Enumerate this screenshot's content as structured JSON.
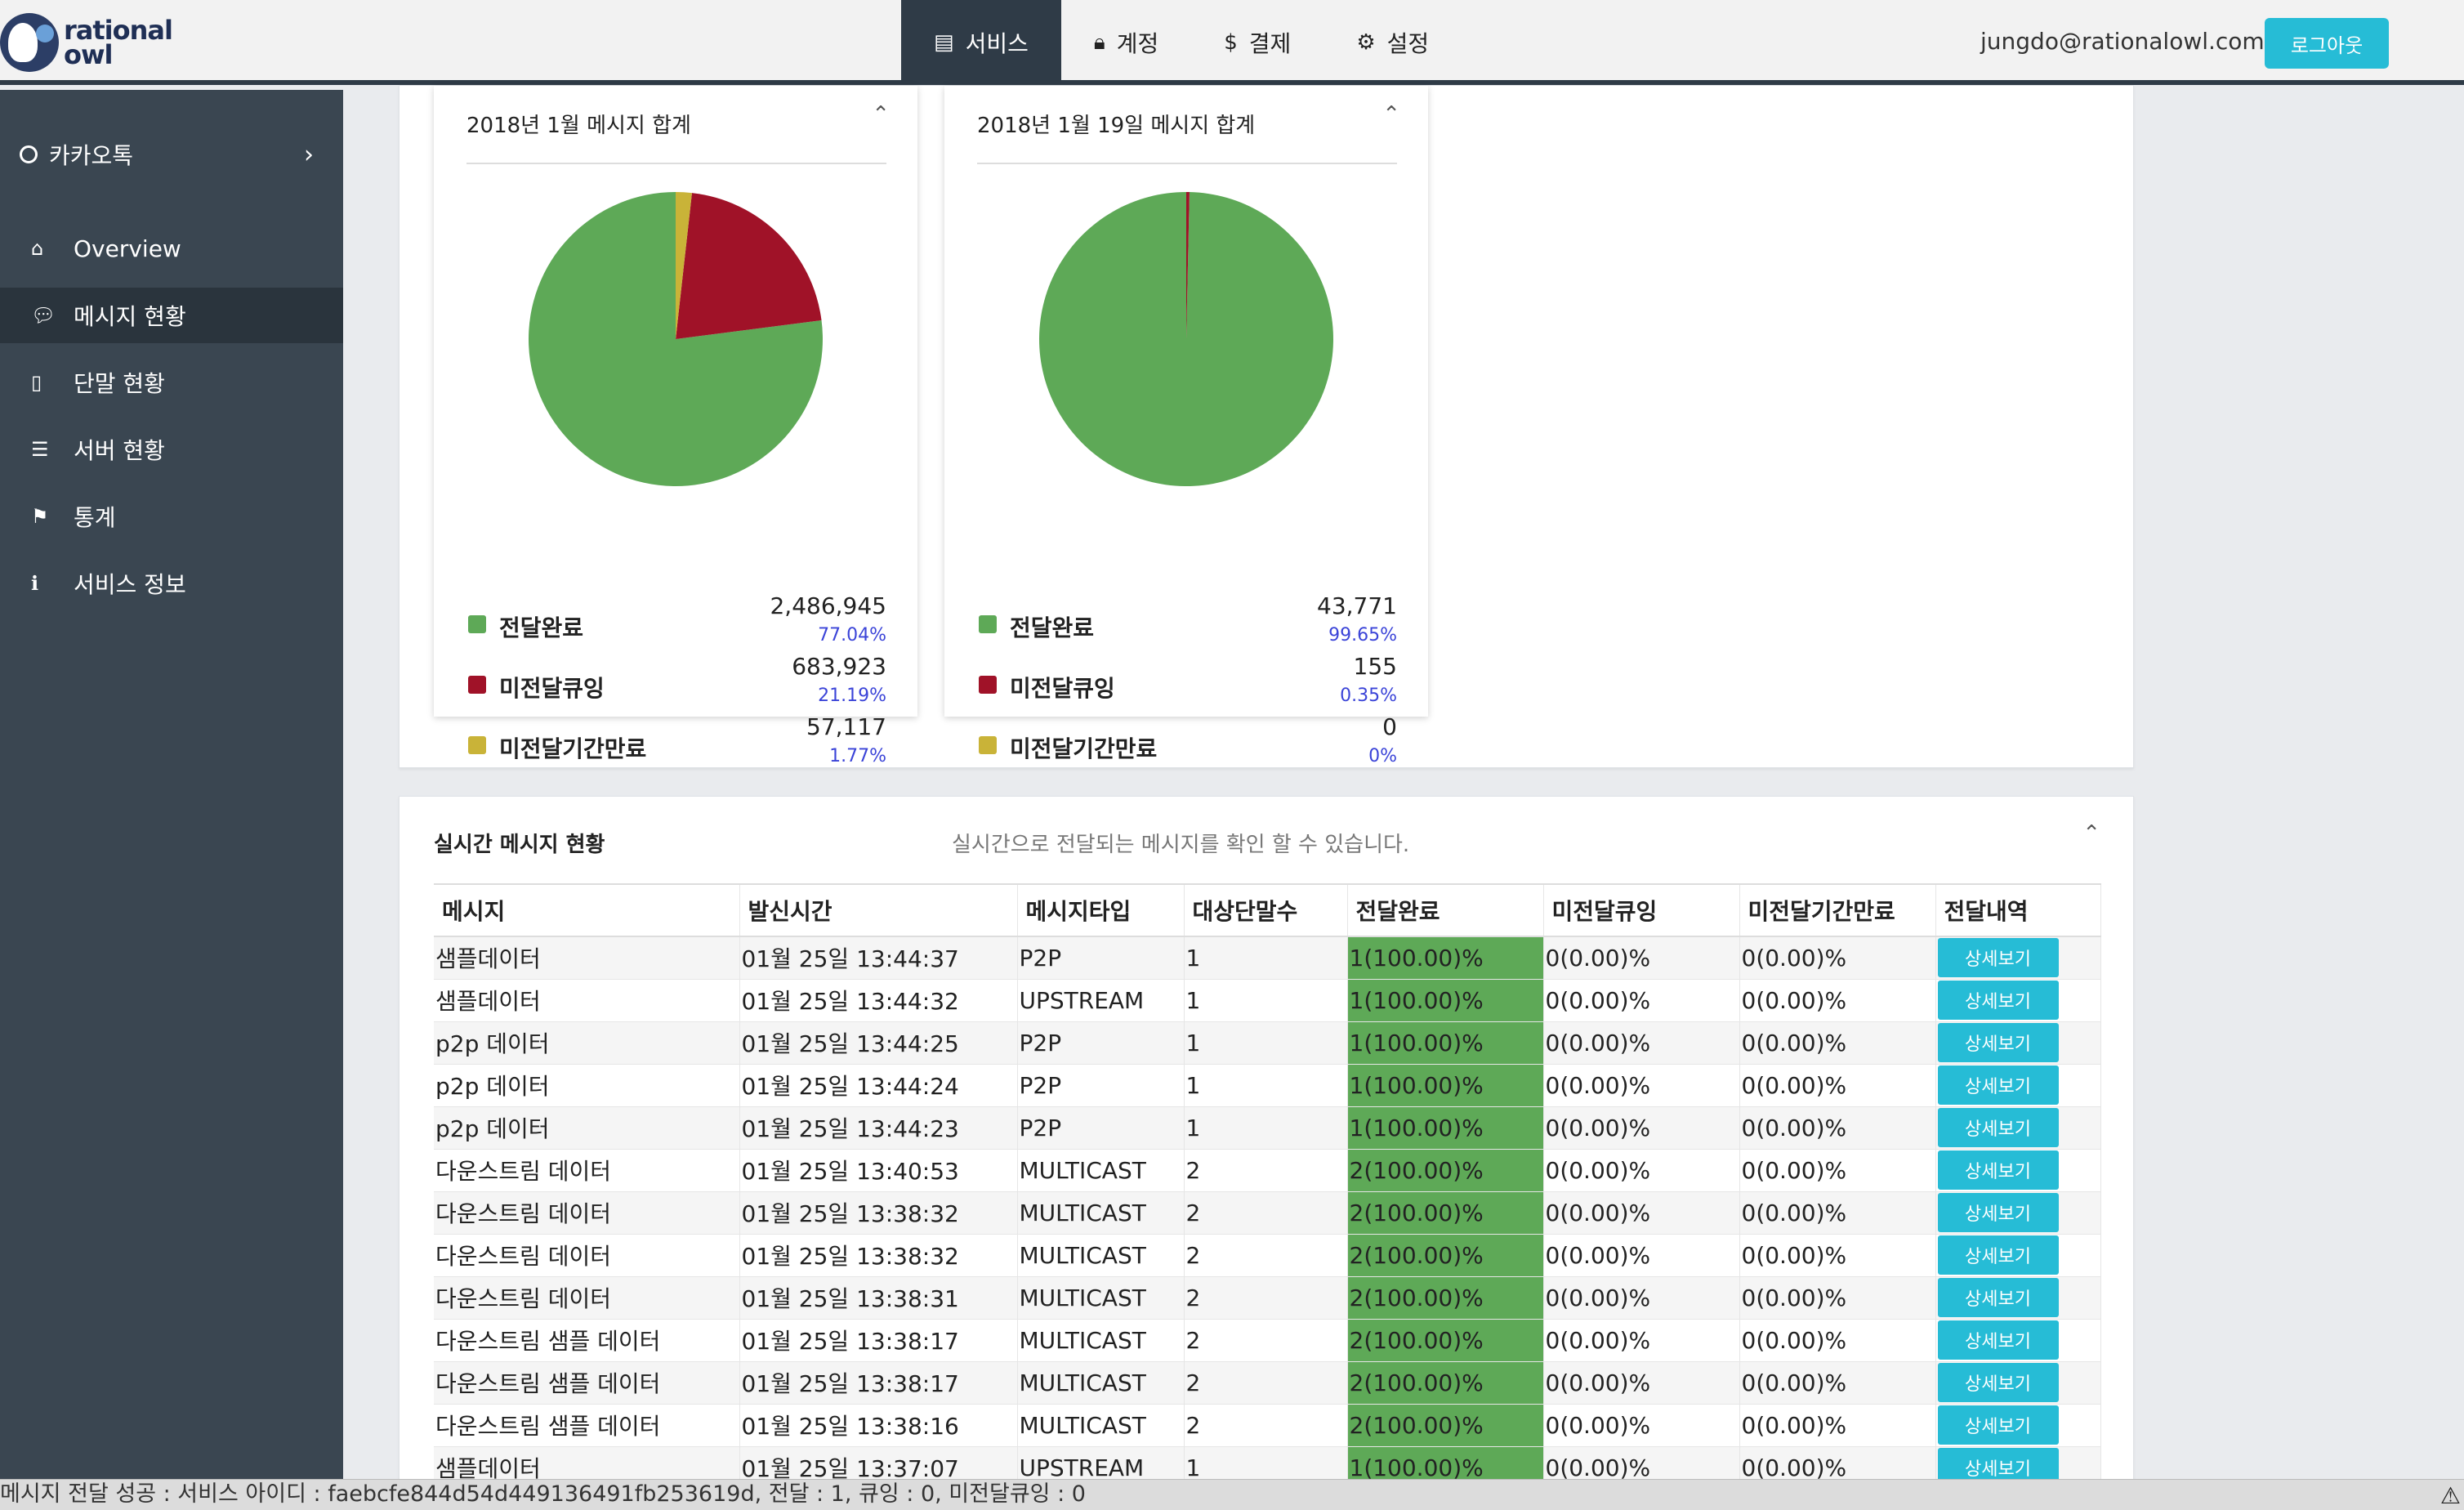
{
  "app": {
    "logo_line1": "rational",
    "logo_line2": "owl"
  },
  "nav": [
    {
      "icon": "▤",
      "label": "서비스",
      "active": true
    },
    {
      "icon": "🔒︎",
      "label": "계정",
      "active": false
    },
    {
      "icon": "$",
      "label": "결제",
      "active": false
    },
    {
      "icon": "⚙",
      "label": "설정",
      "active": false
    }
  ],
  "user": {
    "email": "jungdo@rationalowl.com",
    "logout_label": "로그아웃"
  },
  "sidebar": {
    "app_name": "카카오톡",
    "items": [
      {
        "icon": "⌂",
        "label": "Overview"
      },
      {
        "icon": "💬︎",
        "label": "메시지 현황"
      },
      {
        "icon": "▯",
        "label": "단말 현황"
      },
      {
        "icon": "☰",
        "label": "서버 현황"
      },
      {
        "icon": "⚑",
        "label": "통계"
      },
      {
        "icon": "ℹ",
        "label": "서비스 정보"
      }
    ]
  },
  "summary_cards": [
    {
      "title": "2018년 1월 메시지 합계",
      "legend": [
        {
          "label": "전달완료",
          "count": "2,486,945",
          "pct": "77.04%"
        },
        {
          "label": "미전달큐잉",
          "count": "683,923",
          "pct": "21.19%"
        },
        {
          "label": "미전달기간만료",
          "count": "57,117",
          "pct": "1.77%"
        }
      ]
    },
    {
      "title": "2018년 1월 19일 메시지 합계",
      "legend": [
        {
          "label": "전달완료",
          "count": "43,771",
          "pct": "99.65%"
        },
        {
          "label": "미전달큐잉",
          "count": "155",
          "pct": "0.35%"
        },
        {
          "label": "미전달기간만료",
          "count": "0",
          "pct": "0%"
        }
      ]
    }
  ],
  "chart_data": [
    {
      "type": "pie",
      "categories": [
        "전달완료",
        "미전달큐잉",
        "미전달기간만료"
      ],
      "values": [
        77.04,
        21.19,
        1.77
      ],
      "colors": [
        "#5ea957",
        "#a01228",
        "#c9b338"
      ]
    },
    {
      "type": "pie",
      "categories": [
        "전달완료",
        "미전달큐잉",
        "미전달기간만료"
      ],
      "values": [
        99.65,
        0.35,
        0
      ],
      "colors": [
        "#5ea957",
        "#a01228",
        "#c9b338"
      ]
    }
  ],
  "realtime": {
    "title": "실시간 메시지 현황",
    "subtitle": "실시간으로 전달되는 메시지를 확인 할 수 있습니다.",
    "columns": [
      "메시지",
      "발신시간",
      "메시지타입",
      "대상단말수",
      "전달완료",
      "미전달큐잉",
      "미전달기간만료",
      "전달내역"
    ],
    "detail_label": "상세보기",
    "rows": [
      [
        "샘플데이터",
        "01월 25일 13:44:37",
        "P2P",
        "1",
        "1(100.00)%",
        "0(0.00)%",
        "0(0.00)%"
      ],
      [
        "샘플데이터",
        "01월 25일 13:44:32",
        "UPSTREAM",
        "1",
        "1(100.00)%",
        "0(0.00)%",
        "0(0.00)%"
      ],
      [
        "p2p 데이터",
        "01월 25일 13:44:25",
        "P2P",
        "1",
        "1(100.00)%",
        "0(0.00)%",
        "0(0.00)%"
      ],
      [
        "p2p 데이터",
        "01월 25일 13:44:24",
        "P2P",
        "1",
        "1(100.00)%",
        "0(0.00)%",
        "0(0.00)%"
      ],
      [
        "p2p 데이터",
        "01월 25일 13:44:23",
        "P2P",
        "1",
        "1(100.00)%",
        "0(0.00)%",
        "0(0.00)%"
      ],
      [
        "다운스트림 데이터",
        "01월 25일 13:40:53",
        "MULTICAST",
        "2",
        "2(100.00)%",
        "0(0.00)%",
        "0(0.00)%"
      ],
      [
        "다운스트림 데이터",
        "01월 25일 13:38:32",
        "MULTICAST",
        "2",
        "2(100.00)%",
        "0(0.00)%",
        "0(0.00)%"
      ],
      [
        "다운스트림 데이터",
        "01월 25일 13:38:32",
        "MULTICAST",
        "2",
        "2(100.00)%",
        "0(0.00)%",
        "0(0.00)%"
      ],
      [
        "다운스트림 데이터",
        "01월 25일 13:38:31",
        "MULTICAST",
        "2",
        "2(100.00)%",
        "0(0.00)%",
        "0(0.00)%"
      ],
      [
        "다운스트림 샘플 데이터",
        "01월 25일 13:38:17",
        "MULTICAST",
        "2",
        "2(100.00)%",
        "0(0.00)%",
        "0(0.00)%"
      ],
      [
        "다운스트림 샘플 데이터",
        "01월 25일 13:38:17",
        "MULTICAST",
        "2",
        "2(100.00)%",
        "0(0.00)%",
        "0(0.00)%"
      ],
      [
        "다운스트림 샘플 데이터",
        "01월 25일 13:38:16",
        "MULTICAST",
        "2",
        "2(100.00)%",
        "0(0.00)%",
        "0(0.00)%"
      ],
      [
        "샘플데이터",
        "01월 25일 13:37:07",
        "UPSTREAM",
        "1",
        "1(100.00)%",
        "0(0.00)%",
        "0(0.00)%"
      ]
    ]
  },
  "status_bar": {
    "text": "메시지 전달 성공 : 서비스 아이디 : faebcfe844d54d449136491fb253619d, 전달 : 1, 큐잉 : 0, 미전달큐잉 : 0"
  },
  "colors": {
    "accent": "#26bcd6",
    "sidebar": "#3a4651",
    "delivered": "#5ea957",
    "queued": "#a01228",
    "expired": "#c9b338"
  }
}
